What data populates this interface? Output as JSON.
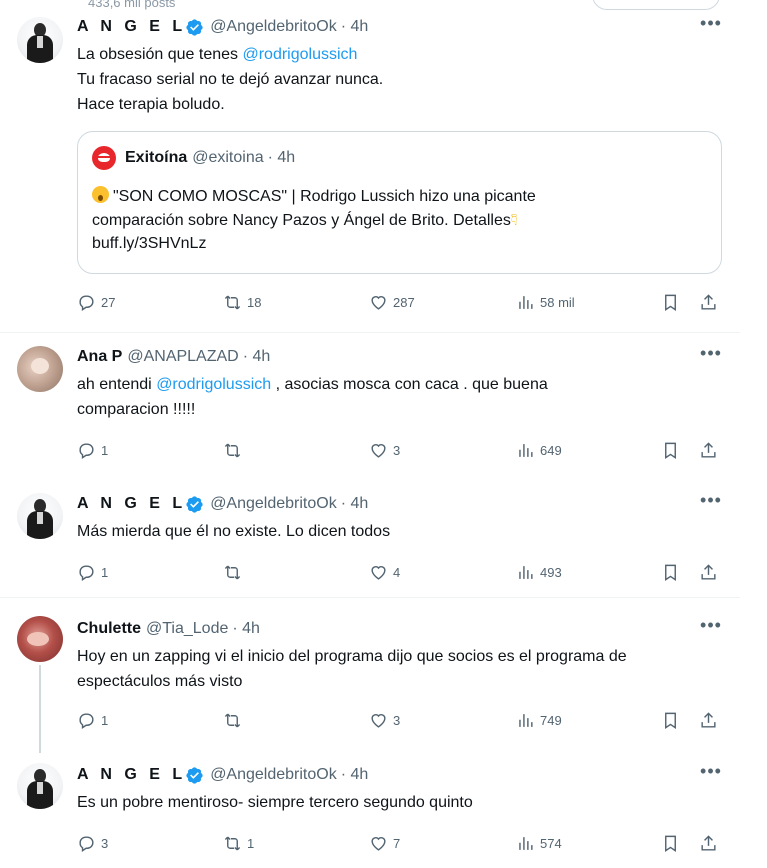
{
  "topbar": {
    "posts_count": "433,6 mil posts"
  },
  "tweets": [
    {
      "name": "A N G E L",
      "verified": true,
      "handle": "@AngeldebritoOk",
      "time": "· 4h",
      "lines": [
        [
          "La obsesión que tenes ",
          "@rodrigolussich",
          ""
        ],
        [
          "Tu fracaso serial no te dejó avanzar nunca.",
          "",
          ""
        ],
        [
          "Hace terapia boludo.",
          "",
          ""
        ]
      ],
      "quote": {
        "name": "Exitoína",
        "handle": "@exitoina",
        "time": "· 4h",
        "text_1": "\"SON COMO MOSCAS\" | Rodrigo Lussich hizo una picante",
        "text_2": "comparación sobre Nancy Pazos y Ángel de Brito. Detalles",
        "text_3": "buff.ly/3SHVnLz"
      },
      "replies": "27",
      "retweets": "18",
      "likes": "287",
      "views": "58 mil"
    },
    {
      "name": "Ana P",
      "verified": false,
      "handle": "@ANAPLAZAD",
      "time": "· 4h",
      "line1_pre": "ah entendi ",
      "line1_mention": "@rodrigolussich",
      "line1_post": " , asocias mosca con caca . que buena",
      "line2": "comparacion !!!!!",
      "replies": "1",
      "retweets": "",
      "likes": "3",
      "views": "649"
    },
    {
      "name": "A N G E L",
      "verified": true,
      "handle": "@AngeldebritoOk",
      "time": "· 4h",
      "line1": "Más mierda que él no existe. Lo dicen todos",
      "replies": "1",
      "retweets": "",
      "likes": "4",
      "views": "493"
    },
    {
      "name": "Chulette",
      "verified": false,
      "handle": "@Tia_Lode",
      "time": "· 4h",
      "line1": "Hoy en un zapping vi el inicio del programa dijo que socios es el programa de",
      "line2": "espectáculos más visto",
      "replies": "1",
      "retweets": "",
      "likes": "3",
      "views": "749"
    },
    {
      "name": "A N G E L",
      "verified": true,
      "handle": "@AngeldebritoOk",
      "time": "· 4h",
      "line1": "Es un pobre mentiroso- siempre tercero segundo quinto",
      "replies": "3",
      "retweets": "1",
      "likes": "7",
      "views": "574"
    }
  ],
  "icons": {
    "more": "more-icon",
    "reply": "reply-icon",
    "retweet": "retweet-icon",
    "like": "heart-icon",
    "views": "views-icon",
    "bookmark": "bookmark-icon",
    "share": "share-icon",
    "verified": "verified-badge-icon"
  },
  "colors": {
    "accent": "#1d9bf0",
    "text": "#0f1419",
    "muted": "#536471",
    "border": "#cfd9de",
    "exitoina_brand": "#e8272c"
  }
}
